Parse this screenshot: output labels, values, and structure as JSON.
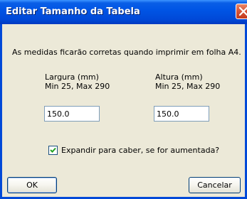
{
  "window": {
    "title": "Editar Tamanho da Tabela"
  },
  "message": "As medidas ficarão corretas quando imprimir em folha A4.",
  "width_field": {
    "label": "Largura (mm)",
    "range": "Min 25, Max 290",
    "value": "150.0"
  },
  "height_field": {
    "label": "Altura (mm)",
    "range": "Min 25, Max 290",
    "value": "150.0"
  },
  "expand_checkbox": {
    "label": "Expandir para caber, se for aumentada?",
    "checked": true
  },
  "buttons": {
    "ok": "OK",
    "cancel": "Cancelar"
  },
  "colors": {
    "titlebar": "#0055E5",
    "dialog_bg": "#ECE9D8",
    "close": "#D8573A"
  }
}
